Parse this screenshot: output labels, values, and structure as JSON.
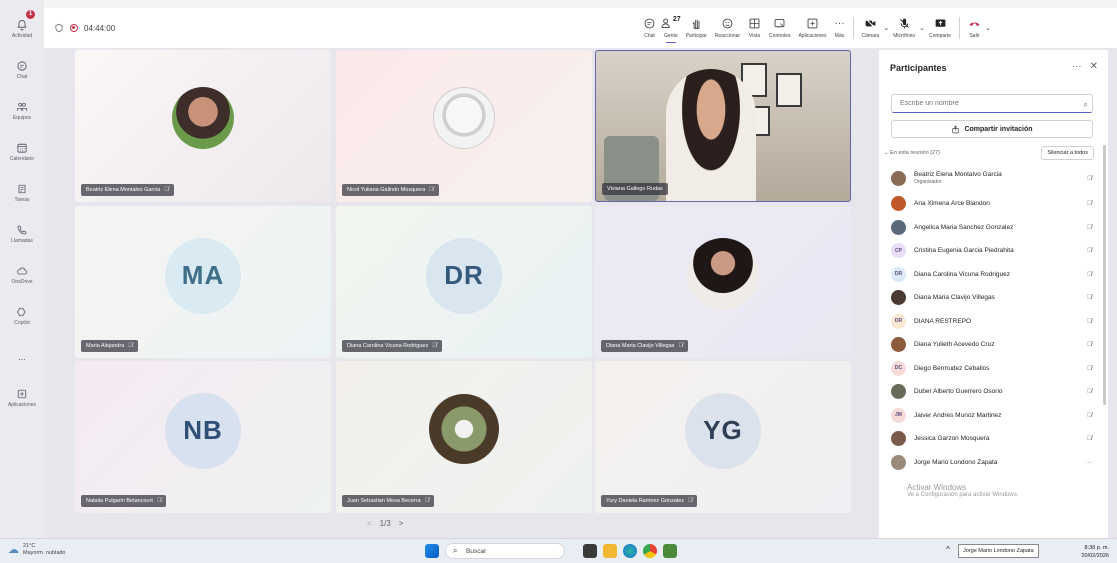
{
  "window": {
    "timer": "04:44:00"
  },
  "rail": [
    {
      "label": "Actividad",
      "icon": "bell-icon",
      "badge": "1"
    },
    {
      "label": "Chat",
      "icon": "chat-icon"
    },
    {
      "label": "Equipos",
      "icon": "teams-icon"
    },
    {
      "label": "Calendario",
      "icon": "calendar-icon"
    },
    {
      "label": "Tareas",
      "icon": "tasks-icon"
    },
    {
      "label": "Llamadas",
      "icon": "phone-icon"
    },
    {
      "label": "OneDrive",
      "icon": "cloud-icon"
    },
    {
      "label": "Copilot",
      "icon": "copilot-icon"
    },
    {
      "label": "...",
      "icon": "more-icon"
    },
    {
      "label": "Aplicaciones",
      "icon": "apps-icon"
    }
  ],
  "toolbar": {
    "chat": "Chat",
    "people": "Gente",
    "people_count": "27",
    "raise": "Participar",
    "react": "Reaccionar",
    "view": "Vista",
    "controls": "Controles",
    "apps": "Aplicaciones",
    "more": "Más",
    "camera": "Cámara",
    "mic": "Micrófono",
    "share": "Comparte",
    "leave": "Salir"
  },
  "tiles": [
    {
      "name": "Beatriz Elena Montalvo Garcia",
      "type": "photo"
    },
    {
      "name": "Nicol Yuliana Galindo Mosquera",
      "type": "photo"
    },
    {
      "name": "Viviana Gallego Rudas",
      "type": "video"
    },
    {
      "name": "Maria Alejandra",
      "type": "initials",
      "initials": "MA"
    },
    {
      "name": "Diana Carolina Vicuna Rodriguez",
      "type": "initials",
      "initials": "DR"
    },
    {
      "name": "Diana Maria Clavijo Villegas",
      "type": "photo"
    },
    {
      "name": "Natalia Pulgarin Betancourt",
      "type": "initials",
      "initials": "NB"
    },
    {
      "name": "Juan Sebastian Mesa Becerra",
      "type": "photo"
    },
    {
      "name": "Yury Daniela Ramirez Gonzalez",
      "type": "initials",
      "initials": "YG"
    }
  ],
  "pager": {
    "prev": "<",
    "label": "1/3",
    "next": ">"
  },
  "panel": {
    "title": "Participantes",
    "search_placeholder": "Escribe un nombre",
    "invite": "Compartir invitación",
    "section": "En esta reunión (27)",
    "mute_all": "Silenciar a todos",
    "participants": [
      {
        "name": "Beatriz Elena Montalvo Garcia",
        "role": "Organizador",
        "avatar": "photo",
        "color": "#8b6a55"
      },
      {
        "name": "Ana Ximena Arce Blandon",
        "avatar": "photo",
        "color": "#c05a2a"
      },
      {
        "name": "Angelica Maria Sanchez Gonzalez",
        "avatar": "photo",
        "color": "#5a6a7a"
      },
      {
        "name": "Cristina Eugenia Garcia Piedrahita",
        "avatar": "initials",
        "initials": "CP",
        "color": "#e9dcf5"
      },
      {
        "name": "Diana Carolina Vicuna Rodriguez",
        "avatar": "initials",
        "initials": "DR",
        "color": "#dbe8f5"
      },
      {
        "name": "Diana Maria Clavijo Villegas",
        "avatar": "photo",
        "color": "#4a3a32"
      },
      {
        "name": "DIANA RESTREPO",
        "avatar": "initials",
        "initials": "DR",
        "color": "#fbe8d4"
      },
      {
        "name": "Diana Yulieth Acevedo Cruz",
        "avatar": "photo",
        "color": "#8a5a3a"
      },
      {
        "name": "Diego Bermudez Ceballos",
        "avatar": "initials",
        "initials": "DC",
        "color": "#f7dada"
      },
      {
        "name": "Duber Alberto Guerrero Osorio",
        "avatar": "photo",
        "color": "#6a6a5a"
      },
      {
        "name": "Jaiver Andres Munoz Martinez",
        "avatar": "initials",
        "initials": "JM",
        "color": "#f7dada"
      },
      {
        "name": "Jessica Garzon Mosquera",
        "avatar": "photo",
        "color": "#7a5a4a"
      },
      {
        "name": "Jorge Mario Londono Zapata",
        "avatar": "photo",
        "color": "#9a8a7a"
      }
    ]
  },
  "watermark": {
    "line1": "Activar Windows",
    "line2": "Ve a Configuración para activar Windows."
  },
  "taskbar": {
    "temp": "21°C",
    "weather": "Mayorm. nublado",
    "search": "Buscar",
    "tooltip": "Jorge Mario Londono Zapata",
    "time": "8:38 p. m.",
    "date": "20/02/2026"
  }
}
